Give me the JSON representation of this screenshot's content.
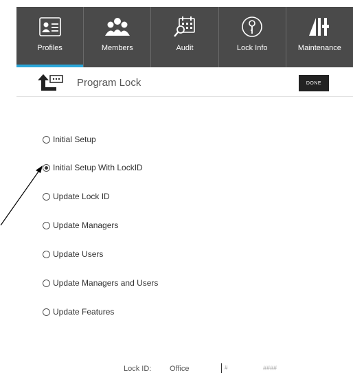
{
  "nav": {
    "items": [
      {
        "label": "Profiles",
        "icon": "profiles-icon",
        "active": true
      },
      {
        "label": "Members",
        "icon": "members-icon",
        "active": false
      },
      {
        "label": "Audit",
        "icon": "audit-icon",
        "active": false
      },
      {
        "label": "Lock Info",
        "icon": "lock-info-icon",
        "active": false
      },
      {
        "label": "Maintenance",
        "icon": "maintenance-icon",
        "active": false
      }
    ],
    "accent_color": "#2aa6d9",
    "background_color": "#4a4a4a"
  },
  "header": {
    "title": "Program Lock",
    "done_label": "DONE",
    "icon": "program-lock-back-icon"
  },
  "options": [
    {
      "label": "Initial Setup",
      "checked": false
    },
    {
      "label": "Initial Setup With LockID",
      "checked": true
    },
    {
      "label": "Update Lock ID",
      "checked": false
    },
    {
      "label": "Update Managers",
      "checked": false
    },
    {
      "label": "Update Users",
      "checked": false
    },
    {
      "label": "Update Managers and Users",
      "checked": false
    },
    {
      "label": "Update Features",
      "checked": false
    }
  ],
  "lock_id": {
    "label": "Lock ID:",
    "name_value": "Office",
    "number_prefix": "#",
    "number_placeholder": "####"
  }
}
